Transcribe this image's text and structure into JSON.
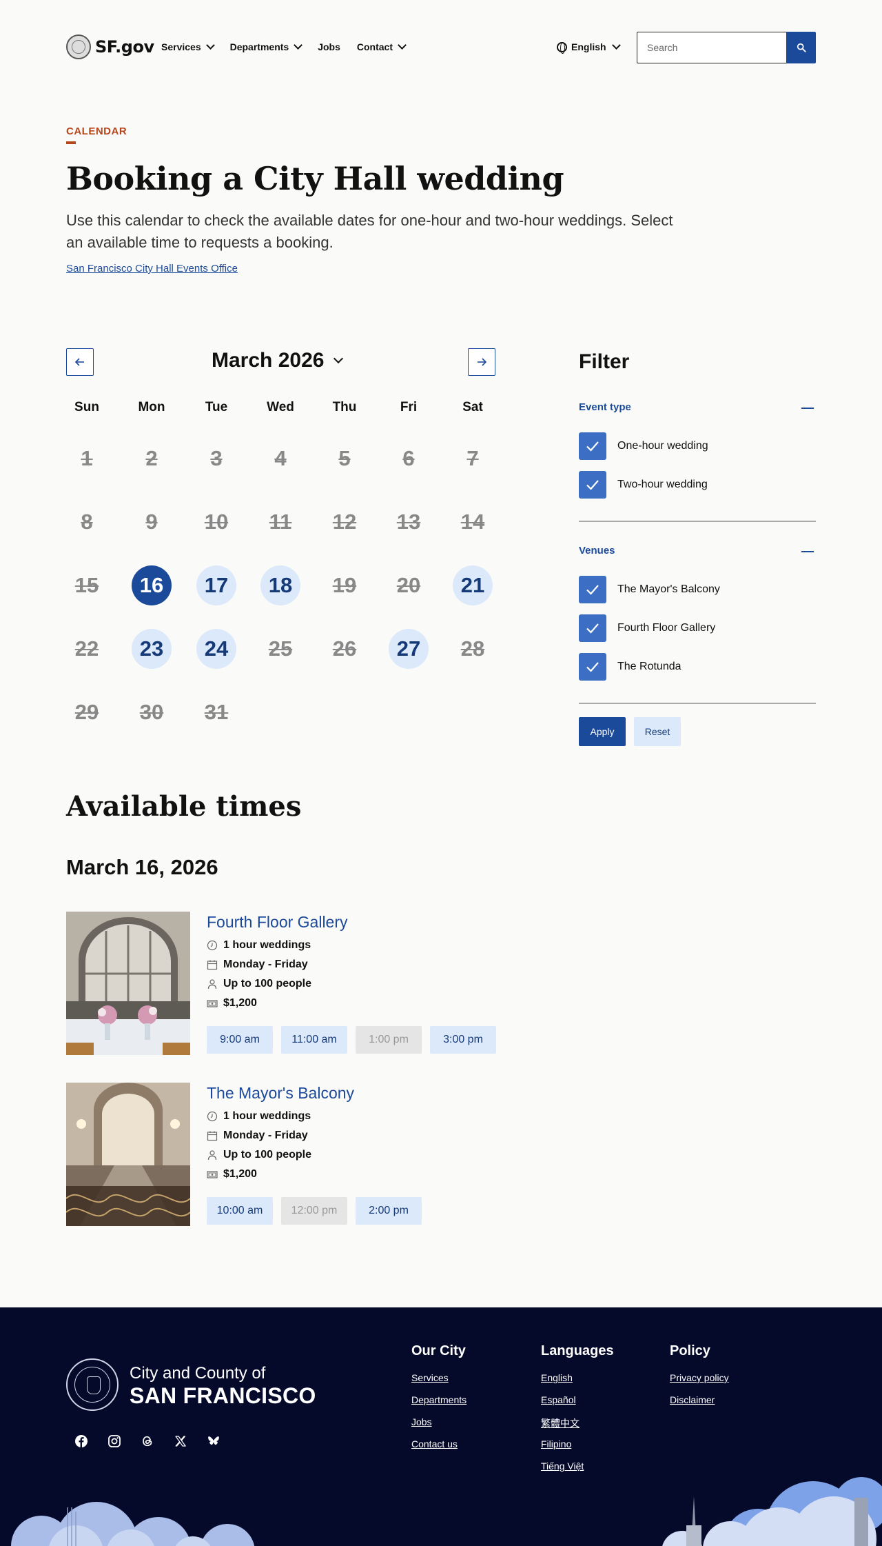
{
  "header": {
    "logo_text": "SF.gov",
    "nav": [
      {
        "label": "Services",
        "has_dropdown": true
      },
      {
        "label": "Departments",
        "has_dropdown": true
      },
      {
        "label": "Jobs",
        "has_dropdown": false
      },
      {
        "label": "Contact",
        "has_dropdown": true
      }
    ],
    "language": "English",
    "search_placeholder": "Search"
  },
  "hero": {
    "eyebrow": "CALENDAR",
    "title": "Booking a City Hall wedding",
    "description": "Use this calendar to check the available dates for one-hour and two-hour weddings. Select an available time to requests a booking.",
    "office_link": "San Francisco City Hall Events Office"
  },
  "calendar": {
    "month_label": "March 2026",
    "weekdays": [
      "Sun",
      "Mon",
      "Tue",
      "Wed",
      "Thu",
      "Fri",
      "Sat"
    ],
    "days": [
      {
        "n": "1",
        "state": "unavailable"
      },
      {
        "n": "2",
        "state": "unavailable"
      },
      {
        "n": "3",
        "state": "unavailable"
      },
      {
        "n": "4",
        "state": "unavailable"
      },
      {
        "n": "5",
        "state": "unavailable"
      },
      {
        "n": "6",
        "state": "unavailable"
      },
      {
        "n": "7",
        "state": "unavailable"
      },
      {
        "n": "8",
        "state": "unavailable"
      },
      {
        "n": "9",
        "state": "unavailable"
      },
      {
        "n": "10",
        "state": "unavailable"
      },
      {
        "n": "11",
        "state": "unavailable"
      },
      {
        "n": "12",
        "state": "unavailable"
      },
      {
        "n": "13",
        "state": "unavailable"
      },
      {
        "n": "14",
        "state": "unavailable"
      },
      {
        "n": "15",
        "state": "unavailable"
      },
      {
        "n": "16",
        "state": "selected"
      },
      {
        "n": "17",
        "state": "available"
      },
      {
        "n": "18",
        "state": "available"
      },
      {
        "n": "19",
        "state": "unavailable"
      },
      {
        "n": "20",
        "state": "unavailable"
      },
      {
        "n": "21",
        "state": "available"
      },
      {
        "n": "22",
        "state": "unavailable"
      },
      {
        "n": "23",
        "state": "available"
      },
      {
        "n": "24",
        "state": "available"
      },
      {
        "n": "25",
        "state": "unavailable"
      },
      {
        "n": "26",
        "state": "unavailable"
      },
      {
        "n": "27",
        "state": "available"
      },
      {
        "n": "28",
        "state": "unavailable"
      },
      {
        "n": "29",
        "state": "unavailable"
      },
      {
        "n": "30",
        "state": "unavailable"
      },
      {
        "n": "31",
        "state": "unavailable"
      }
    ]
  },
  "filter": {
    "title": "Filter",
    "sections": [
      {
        "title": "Event type",
        "options": [
          {
            "label": "One-hour wedding",
            "checked": true
          },
          {
            "label": "Two-hour wedding",
            "checked": true
          }
        ]
      },
      {
        "title": "Venues",
        "options": [
          {
            "label": "The Mayor's Balcony",
            "checked": true
          },
          {
            "label": "Fourth Floor Gallery",
            "checked": true
          },
          {
            "label": "The Rotunda",
            "checked": true
          }
        ]
      }
    ],
    "apply_label": "Apply",
    "reset_label": "Reset"
  },
  "available": {
    "title": "Available times",
    "date": "March 16, 2026",
    "venues": [
      {
        "name": "Fourth Floor Gallery",
        "duration": "1 hour weddings",
        "days": "Monday - Friday",
        "capacity": "Up to 100 people",
        "price": "$1,200",
        "slots": [
          {
            "time": "9:00 am",
            "open": true
          },
          {
            "time": "11:00 am",
            "open": true
          },
          {
            "time": "1:00 pm",
            "open": false
          },
          {
            "time": "3:00 pm",
            "open": true
          }
        ]
      },
      {
        "name": "The Mayor's Balcony",
        "duration": "1 hour weddings",
        "days": "Monday - Friday",
        "capacity": "Up to 100 people",
        "price": "$1,200",
        "slots": [
          {
            "time": "10:00 am",
            "open": true
          },
          {
            "time": "12:00 pm",
            "open": false
          },
          {
            "time": "2:00 pm",
            "open": true
          }
        ]
      }
    ]
  },
  "footer": {
    "city_line1": "City and County of",
    "city_line2": "SAN FRANCISCO",
    "social_icons": [
      "facebook-icon",
      "instagram-icon",
      "threads-icon",
      "x-icon",
      "bluesky-icon"
    ],
    "columns": [
      {
        "title": "Our City",
        "links": [
          "Services",
          "Departments",
          "Jobs",
          "Contact us"
        ]
      },
      {
        "title": "Languages",
        "links": [
          "English",
          "Español",
          "繁體中文",
          "Filipino",
          "Tiếng Việt"
        ]
      },
      {
        "title": "Policy",
        "links": [
          "Privacy policy",
          "Disclaimer"
        ]
      }
    ]
  },
  "colors": {
    "brand_blue": "#1c4a9a",
    "accent_orange": "#b5451b",
    "available_bg": "#dbe9fa",
    "footer_bg": "#050a2b"
  }
}
